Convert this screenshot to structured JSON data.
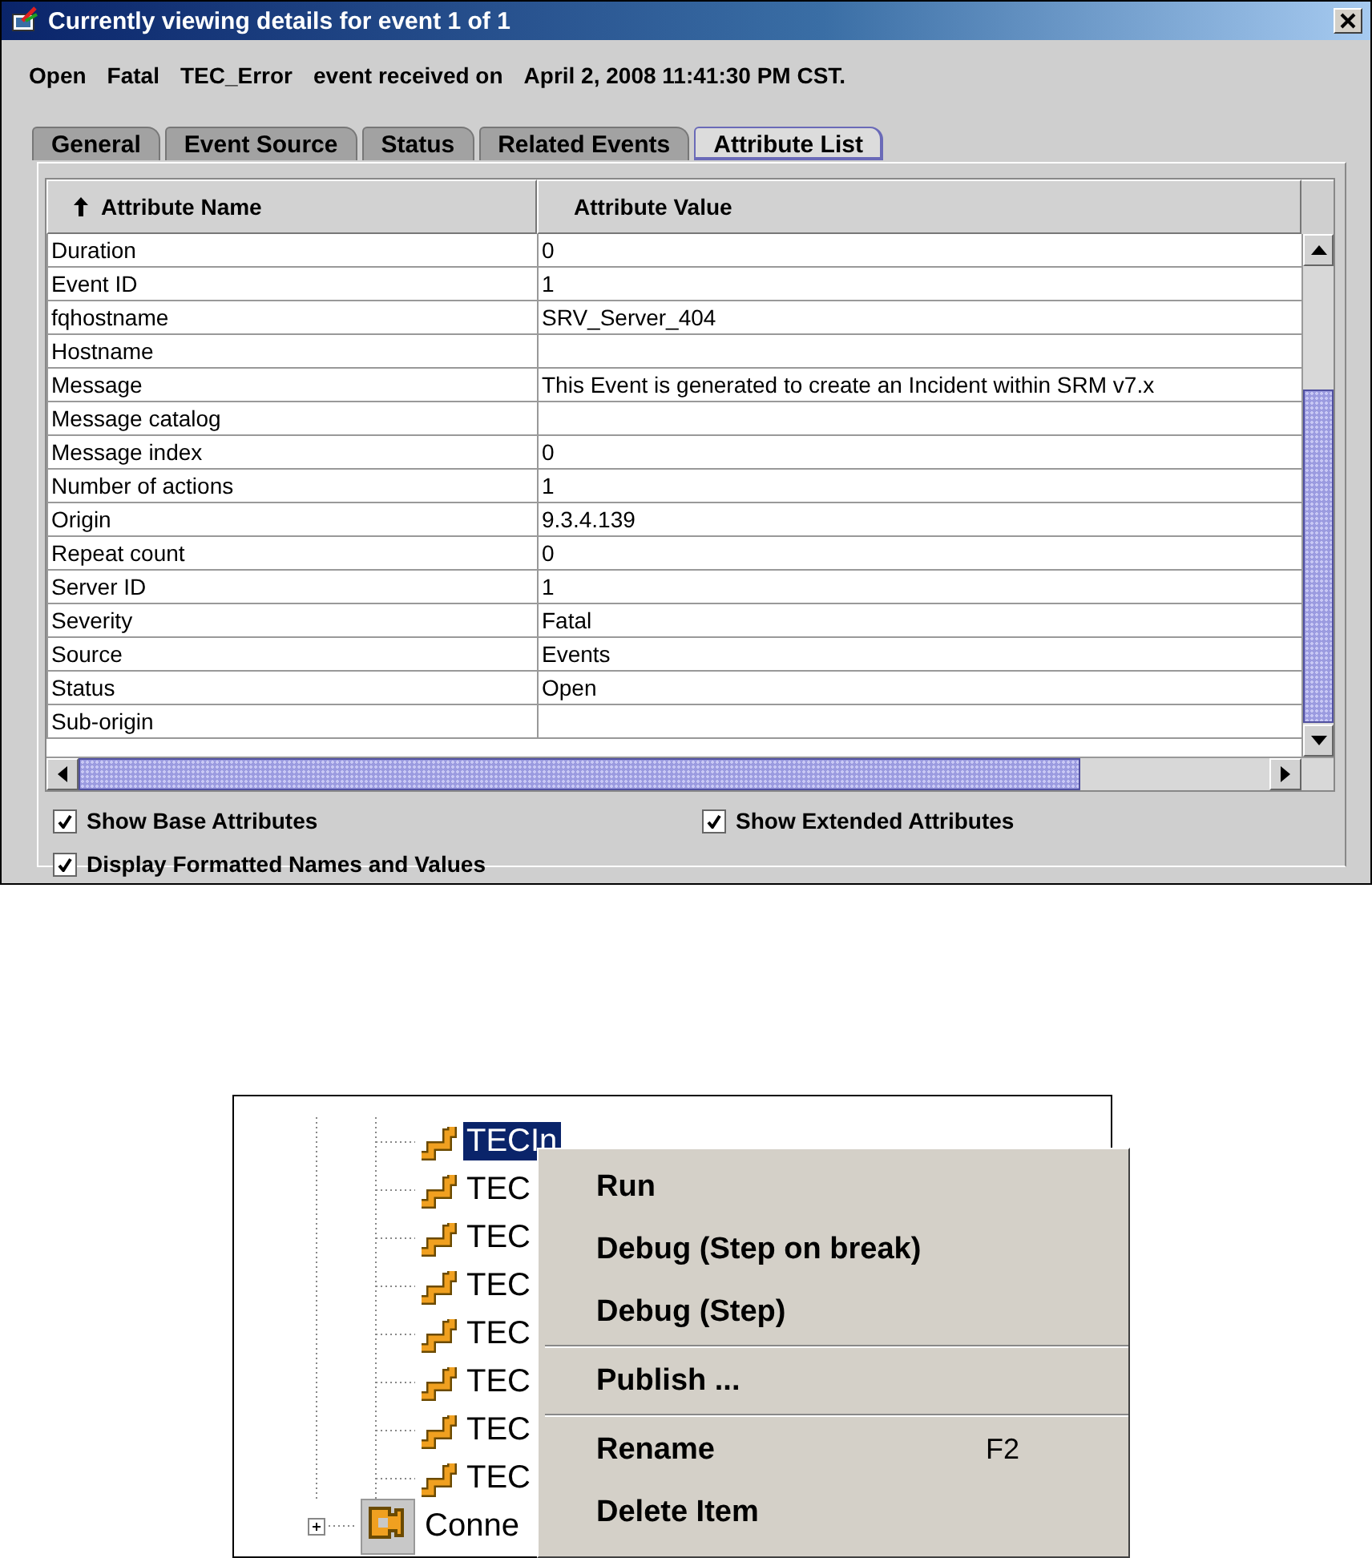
{
  "window": {
    "title": "Currently viewing details for event 1 of 1"
  },
  "summary": [
    "Open",
    "Fatal",
    "TEC_Error",
    "event received on",
    "April 2, 2008 11:41:30 PM CST."
  ],
  "tabs": [
    {
      "label": "General",
      "selected": false
    },
    {
      "label": "Event Source",
      "selected": false
    },
    {
      "label": "Status",
      "selected": false
    },
    {
      "label": "Related Events",
      "selected": false
    },
    {
      "label": "Attribute List",
      "selected": true
    }
  ],
  "table": {
    "columns": [
      {
        "label": "Attribute Name",
        "sorted": true
      },
      {
        "label": "Attribute Value",
        "sorted": false
      }
    ],
    "rows": [
      {
        "name": "Duration",
        "value": "0"
      },
      {
        "name": "Event ID",
        "value": "1"
      },
      {
        "name": "fqhostname",
        "value": "SRV_Server_404"
      },
      {
        "name": "Hostname",
        "value": ""
      },
      {
        "name": "Message",
        "value": "This Event is generated to create an Incident within SRM v7.x"
      },
      {
        "name": "Message catalog",
        "value": ""
      },
      {
        "name": "Message index",
        "value": "0"
      },
      {
        "name": "Number of actions",
        "value": "1"
      },
      {
        "name": "Origin",
        "value": "9.3.4.139"
      },
      {
        "name": "Repeat count",
        "value": "0"
      },
      {
        "name": "Server ID",
        "value": "1"
      },
      {
        "name": "Severity",
        "value": "Fatal"
      },
      {
        "name": "Source",
        "value": "Events"
      },
      {
        "name": "Status",
        "value": "Open"
      },
      {
        "name": "Sub-origin",
        "value": ""
      }
    ]
  },
  "options": [
    {
      "label": "Show Base Attributes",
      "checked": true
    },
    {
      "label": "Show Extended Attributes",
      "checked": true
    },
    {
      "label": "Display Formatted Names and Values",
      "checked": true
    }
  ],
  "tree": {
    "items": [
      {
        "kind": "leaf",
        "label": "TECIn",
        "selected": true
      },
      {
        "kind": "leaf",
        "label": "TEC",
        "selected": false
      },
      {
        "kind": "leaf",
        "label": "TEC",
        "selected": false
      },
      {
        "kind": "leaf",
        "label": "TEC",
        "selected": false
      },
      {
        "kind": "leaf",
        "label": "TEC",
        "selected": false
      },
      {
        "kind": "leaf",
        "label": "TEC",
        "selected": false
      },
      {
        "kind": "leaf",
        "label": "TEC",
        "selected": false
      },
      {
        "kind": "leaf",
        "label": "TEC",
        "selected": false
      },
      {
        "kind": "folder",
        "label": "Conne",
        "selected": false
      }
    ]
  },
  "context_menu": {
    "items": [
      {
        "kind": "item",
        "label": "Run"
      },
      {
        "kind": "item",
        "label": "Debug (Step on break)"
      },
      {
        "kind": "item",
        "label": "Debug (Step)"
      },
      {
        "kind": "separator"
      },
      {
        "kind": "item",
        "label": "Publish ..."
      },
      {
        "kind": "separator"
      },
      {
        "kind": "item",
        "label": "Rename",
        "shortcut": "F2"
      },
      {
        "kind": "item",
        "label": "Delete Item"
      }
    ]
  }
}
